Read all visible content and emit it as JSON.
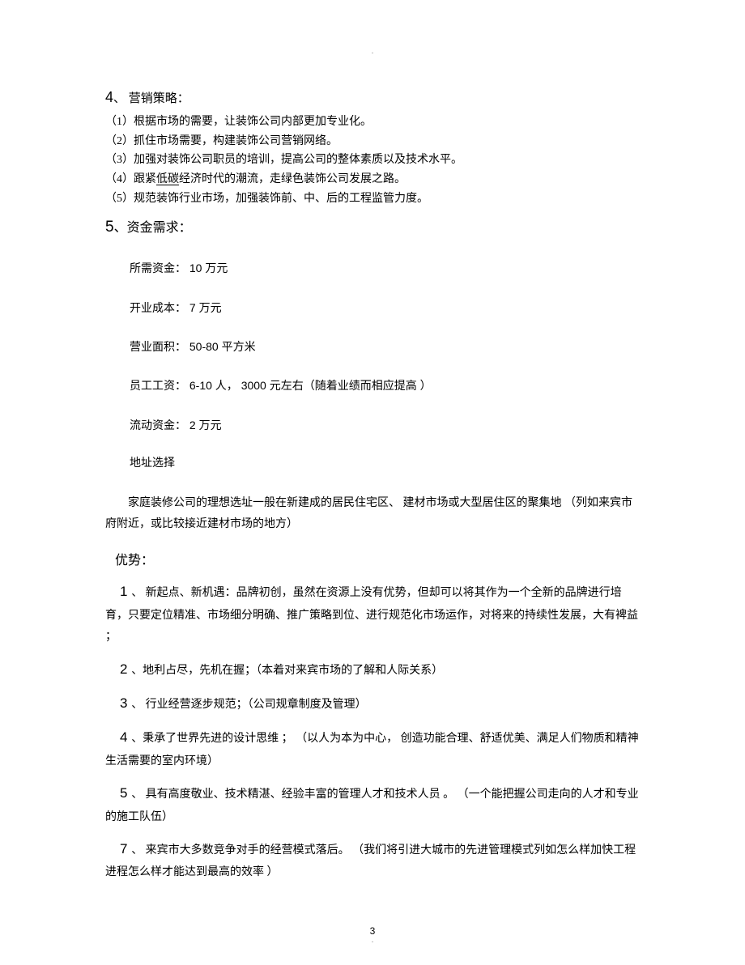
{
  "top_marker": ".",
  "bot_marker": ".",
  "section4": {
    "num": "4",
    "title": "、 营销策略：",
    "items": [
      "（1）根据市场的需要，让装饰公司内部更加专业化。",
      "（2）抓住市场需要，构建装饰公司营销网络。",
      "（3）加强对装饰公司职员的培训，提高公司的整体素质以及技术水平。"
    ],
    "item4_prefix": "（4）跟紧",
    "item4_underline": "低碳",
    "item4_suffix": "经济时代的潮流，走绿色装饰公司发展之路。",
    "item5": "（5）规范装饰行业市场，加强装饰前、中、后的工程监管力度。"
  },
  "section5": {
    "num": "5",
    "title": "、资金需求：",
    "funds": {
      "need_label": "所需资金：",
      "need_value": " 10 万元",
      "startup_label": "开业成本：",
      "startup_value": " 7 万元",
      "area_label": "营业面积：",
      "area_value": " 50-80  平方米",
      "salary_label": "员工工资：",
      "salary_value": " 6-10 人， 3000 元左右（随着业绩而相应提高       ）",
      "liquid_label": "流动资金：",
      "liquid_value": " 2 万元",
      "addr_label": "地址选择"
    },
    "addr_desc": "　　家庭装修公司的理想选址一般在新建成的居民住宅区、 建材市场或大型居住区的聚集地 （列如来宾市府附近，或比较接近建材市场的地方）"
  },
  "advantages": {
    "title": "优势：",
    "items": [
      {
        "num": "1 ",
        "text": "、 新起点、新机遇：品牌初创，虽然在资源上没有优势，但却可以将其作为一个全新的品牌进行培育，只要定位精准、市场细分明确、推广策略到位、进行规范化市场运作，对将来的持续性发展，大有裨益  ；"
      },
      {
        "num": "2 ",
        "text": "、地利占尽，先机在握；（本着对来宾市场的了解和人际关系）"
      },
      {
        "num": "3 ",
        "text": "、 行业经营逐步规范；（公司规章制度及管理）"
      },
      {
        "num": "4 ",
        "text": "、秉承了世界先进的设计思维   ；  （以人为本为中心， 创造功能合理、舒适优美、满足人们物质和精神生活需要的室内环境）"
      },
      {
        "num": "5 ",
        "text": "、 具有高度敬业、技术精湛、经验丰富的管理人才和技术人员   。 （一个能把握公司走向的人才和专业的施工队伍）"
      },
      {
        "num": "7 ",
        "text": "、 来宾市大多数竞争对手的经营模式落后。     （我们将引进大城市的先进管理模式列如怎么样加快工程进程怎么样才能达到最高的效率   ）"
      }
    ]
  },
  "page_number": "3"
}
